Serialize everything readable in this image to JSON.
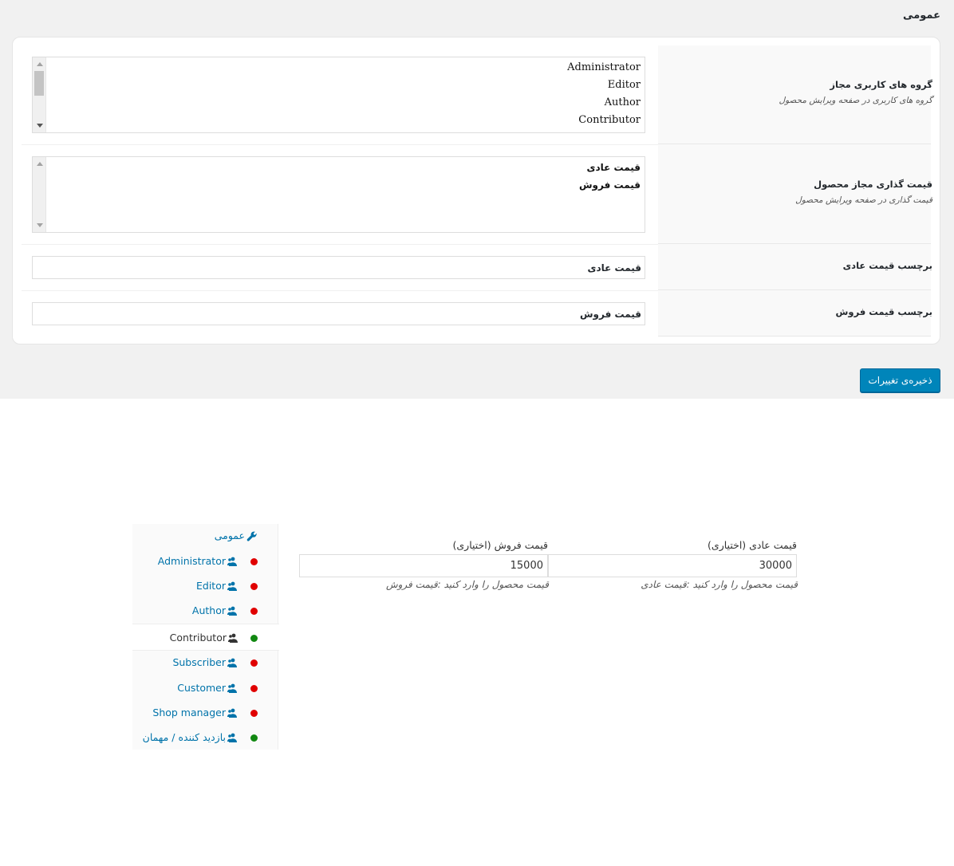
{
  "settings": {
    "section_title": "عمومی",
    "rows": {
      "user_groups": {
        "label": "گروه های کاربری مجاز",
        "description": "گروه های کاربری در صفحه ویرایش محصول",
        "options": [
          "Administrator",
          "Editor",
          "Author",
          "Contributor"
        ]
      },
      "pricing": {
        "label": "قیمت گذاری مجاز محصول",
        "description": "قیمت گذاری در صفحه ویرایش محصول",
        "options": [
          "قیمت عادی",
          "قیمت فروش"
        ]
      },
      "regular_label": {
        "label": "برچسب قیمت عادی",
        "value": "قیمت عادی"
      },
      "sale_label": {
        "label": "برچسب قیمت فروش",
        "value": "قیمت فروش"
      }
    },
    "save_label": "ذخیره‌ی تغییرات"
  },
  "product_panel": {
    "general_tab": "عمومی",
    "roles": [
      {
        "name": "Administrator",
        "status": "red"
      },
      {
        "name": "Editor",
        "status": "red"
      },
      {
        "name": "Author",
        "status": "red"
      },
      {
        "name": "Contributor",
        "status": "green",
        "active": true
      },
      {
        "name": "Subscriber",
        "status": "red"
      },
      {
        "name": "Customer",
        "status": "red"
      },
      {
        "name": "Shop manager",
        "status": "red"
      },
      {
        "name": "بازدید کننده / مهمان",
        "status": "green"
      }
    ],
    "regular_price": {
      "label": "قیمت عادی (اختیاری)",
      "value": "30000",
      "description": "قیمت محصول را وارد کنید :قیمت عادی"
    },
    "sale_price": {
      "label": "قیمت فروش (اختیاری)",
      "value": "15000",
      "description": "قیمت محصول را وارد کنید :قیمت فروش"
    }
  },
  "colors": {
    "link": "#0073aa",
    "button": "#0085ba",
    "status_red": "#e00000",
    "status_green": "#118811"
  }
}
